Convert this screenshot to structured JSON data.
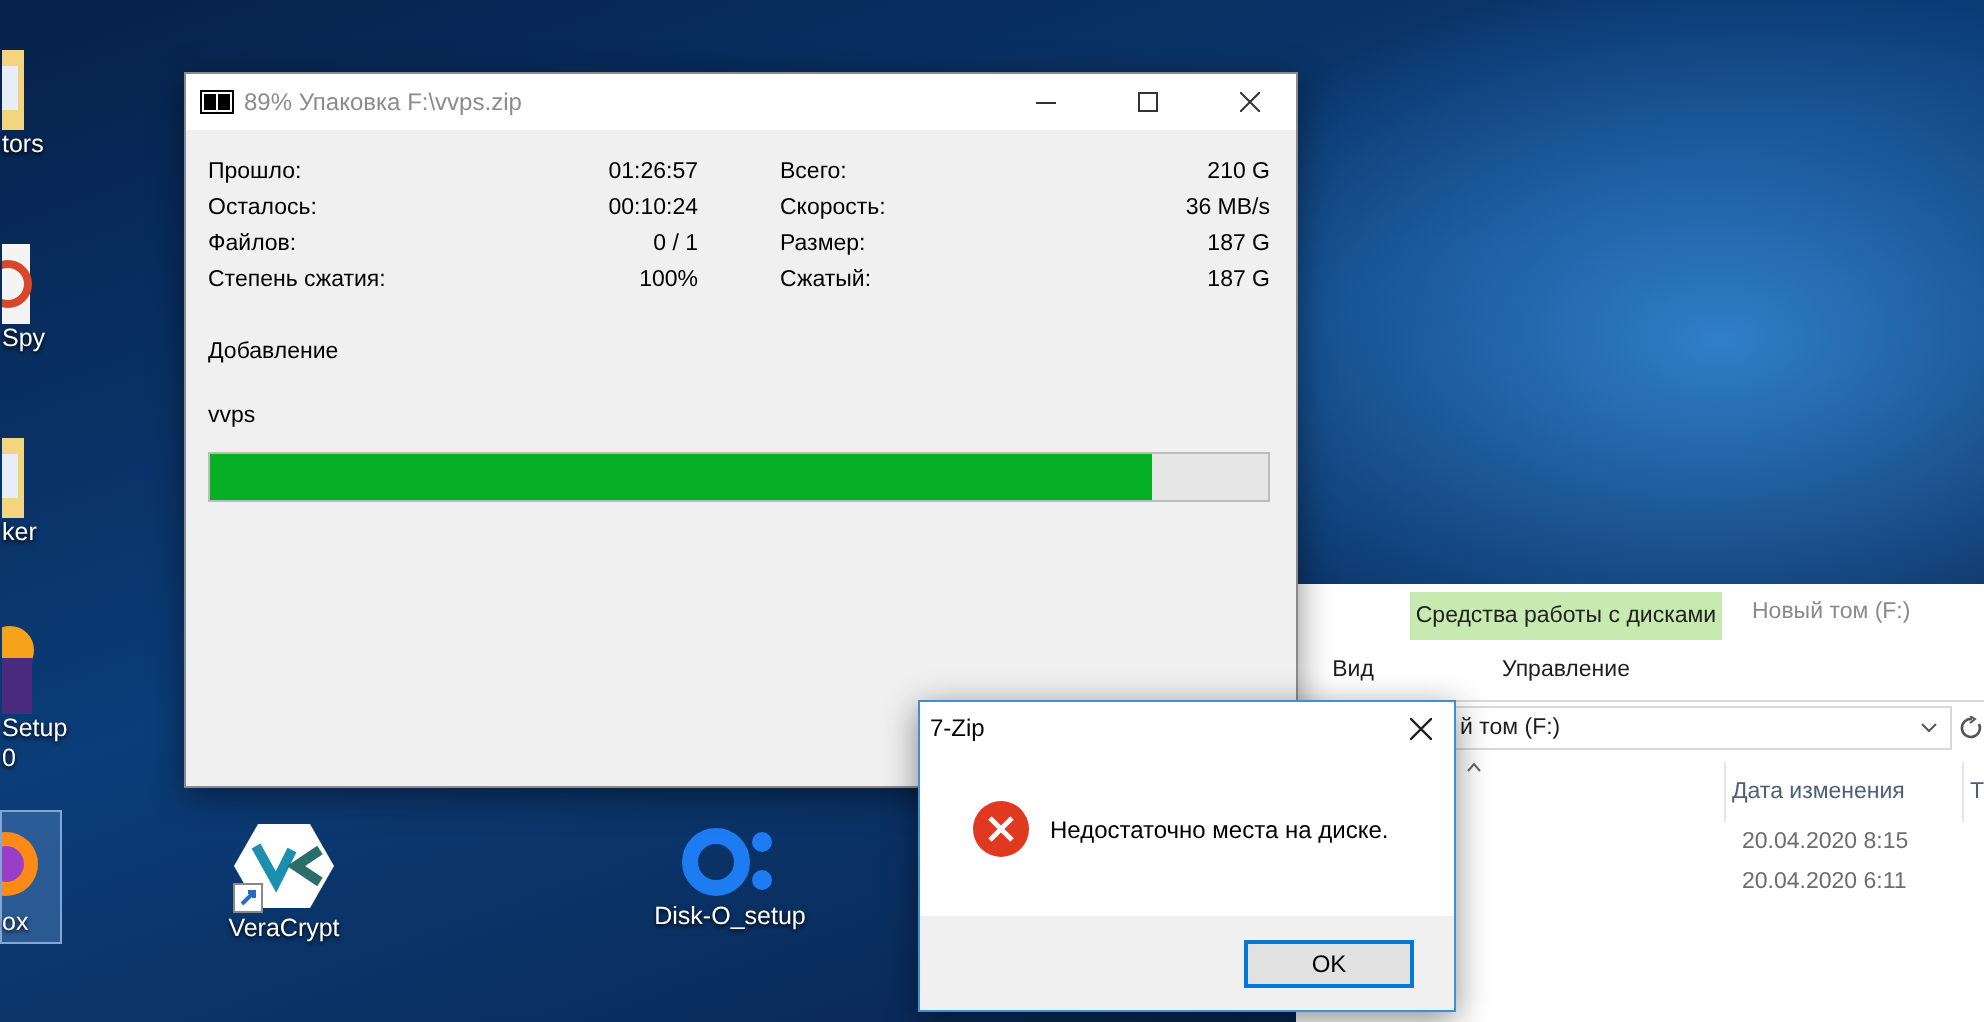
{
  "desktop": {
    "icons": [
      {
        "kind": "folder",
        "label": [
          "tors"
        ],
        "selected": false
      },
      {
        "kind": "spy",
        "label": [
          "Spy"
        ],
        "selected": false
      },
      {
        "kind": "folder",
        "label": [
          "ker"
        ],
        "selected": false
      },
      {
        "kind": "setup",
        "label": [
          "Setup",
          "0"
        ],
        "selected": false
      },
      {
        "kind": "firefox",
        "label": [
          "ox"
        ],
        "selected": true
      },
      {
        "kind": "veracrypt",
        "label": [
          "VeraCrypt"
        ],
        "selected": false
      },
      {
        "kind": "disko",
        "label": [
          "Disk-O_setup"
        ],
        "selected": false
      }
    ]
  },
  "explorer": {
    "context_group": "Средства работы с дисками",
    "title": "Новый том (F:)",
    "tabs": [
      {
        "label": "Вид",
        "selected": false
      },
      {
        "label": "Управление",
        "selected": false
      }
    ],
    "address": "й том (F:)",
    "columns": [
      "Дата изменения",
      "Т"
    ],
    "rows": [
      {
        "date": "20.04.2020 8:15"
      },
      {
        "date": "20.04.2020 6:11"
      }
    ]
  },
  "progress_window": {
    "title": "89% Упаковка F:\\vvps.zip",
    "stats_left": [
      {
        "label": "Прошло:",
        "value": "01:26:57"
      },
      {
        "label": "Осталось:",
        "value": "00:10:24"
      },
      {
        "label": "Файлов:",
        "value": "0 / 1"
      },
      {
        "label": "Степень сжатия:",
        "value": "100%"
      }
    ],
    "stats_right": [
      {
        "label": "Всего:",
        "value": "210 G"
      },
      {
        "label": "Скорость:",
        "value": "36 MB/s"
      },
      {
        "label": "Размер:",
        "value": "187 G"
      },
      {
        "label": "Сжатый:",
        "value": "187 G"
      }
    ],
    "operation": "Добавление",
    "file": "vvps",
    "level": 0.89
  },
  "dialog": {
    "title": "7-Zip",
    "message": "Недостаточно места на диске.",
    "button": "OK"
  }
}
